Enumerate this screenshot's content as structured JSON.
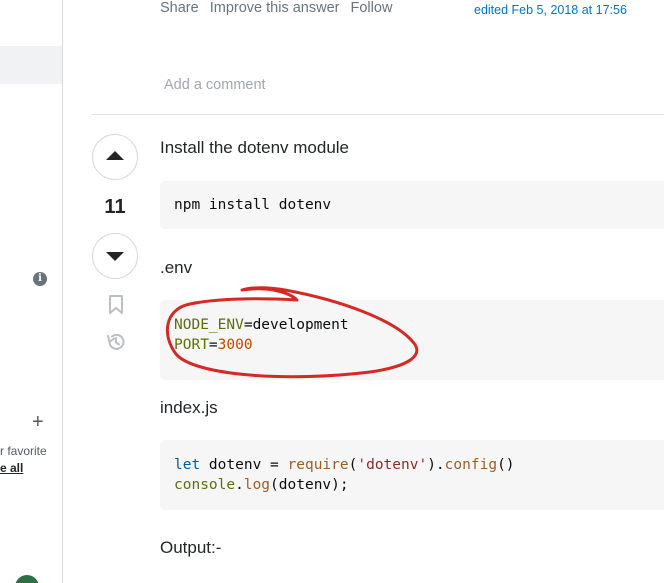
{
  "post_menu": {
    "share": "Share",
    "improve": "Improve this answer",
    "follow": "Follow",
    "edited": "edited Feb 5, 2018 at 17:56"
  },
  "comments": {
    "add_comment": "Add a comment"
  },
  "sidebar": {
    "favorite_text": "r favorite",
    "see_all": "e all"
  },
  "answer": {
    "score": "11",
    "intro": "Install the dotenv module",
    "install_cmd": "npm install dotenv",
    "env_label": ".env",
    "env_lines": [
      {
        "key": "NODE_ENV",
        "sep": "=",
        "value": "development"
      },
      {
        "key": "PORT",
        "sep": "=",
        "value": "3000"
      }
    ],
    "index_label": "index.js",
    "index_code": {
      "line1": {
        "kw": "let",
        "rest1": " dotenv = ",
        "fn1": "require",
        "p1": "(",
        "str": "'dotenv'",
        "p2": ").",
        "fn2": "config",
        "p3": "()"
      },
      "line2": {
        "obj": "console",
        "dot": ".",
        "fn": "log",
        "rest": "(dotenv);"
      }
    },
    "output_label": "Output:-"
  },
  "colors": {
    "link": "#0074cc",
    "muted": "#6a737c",
    "annotation": "#d42a26",
    "code_bg": "#f6f6f6"
  },
  "icons": [
    "info-icon",
    "plus-icon",
    "upvote-icon",
    "downvote-icon",
    "bookmark-icon",
    "history-icon"
  ]
}
